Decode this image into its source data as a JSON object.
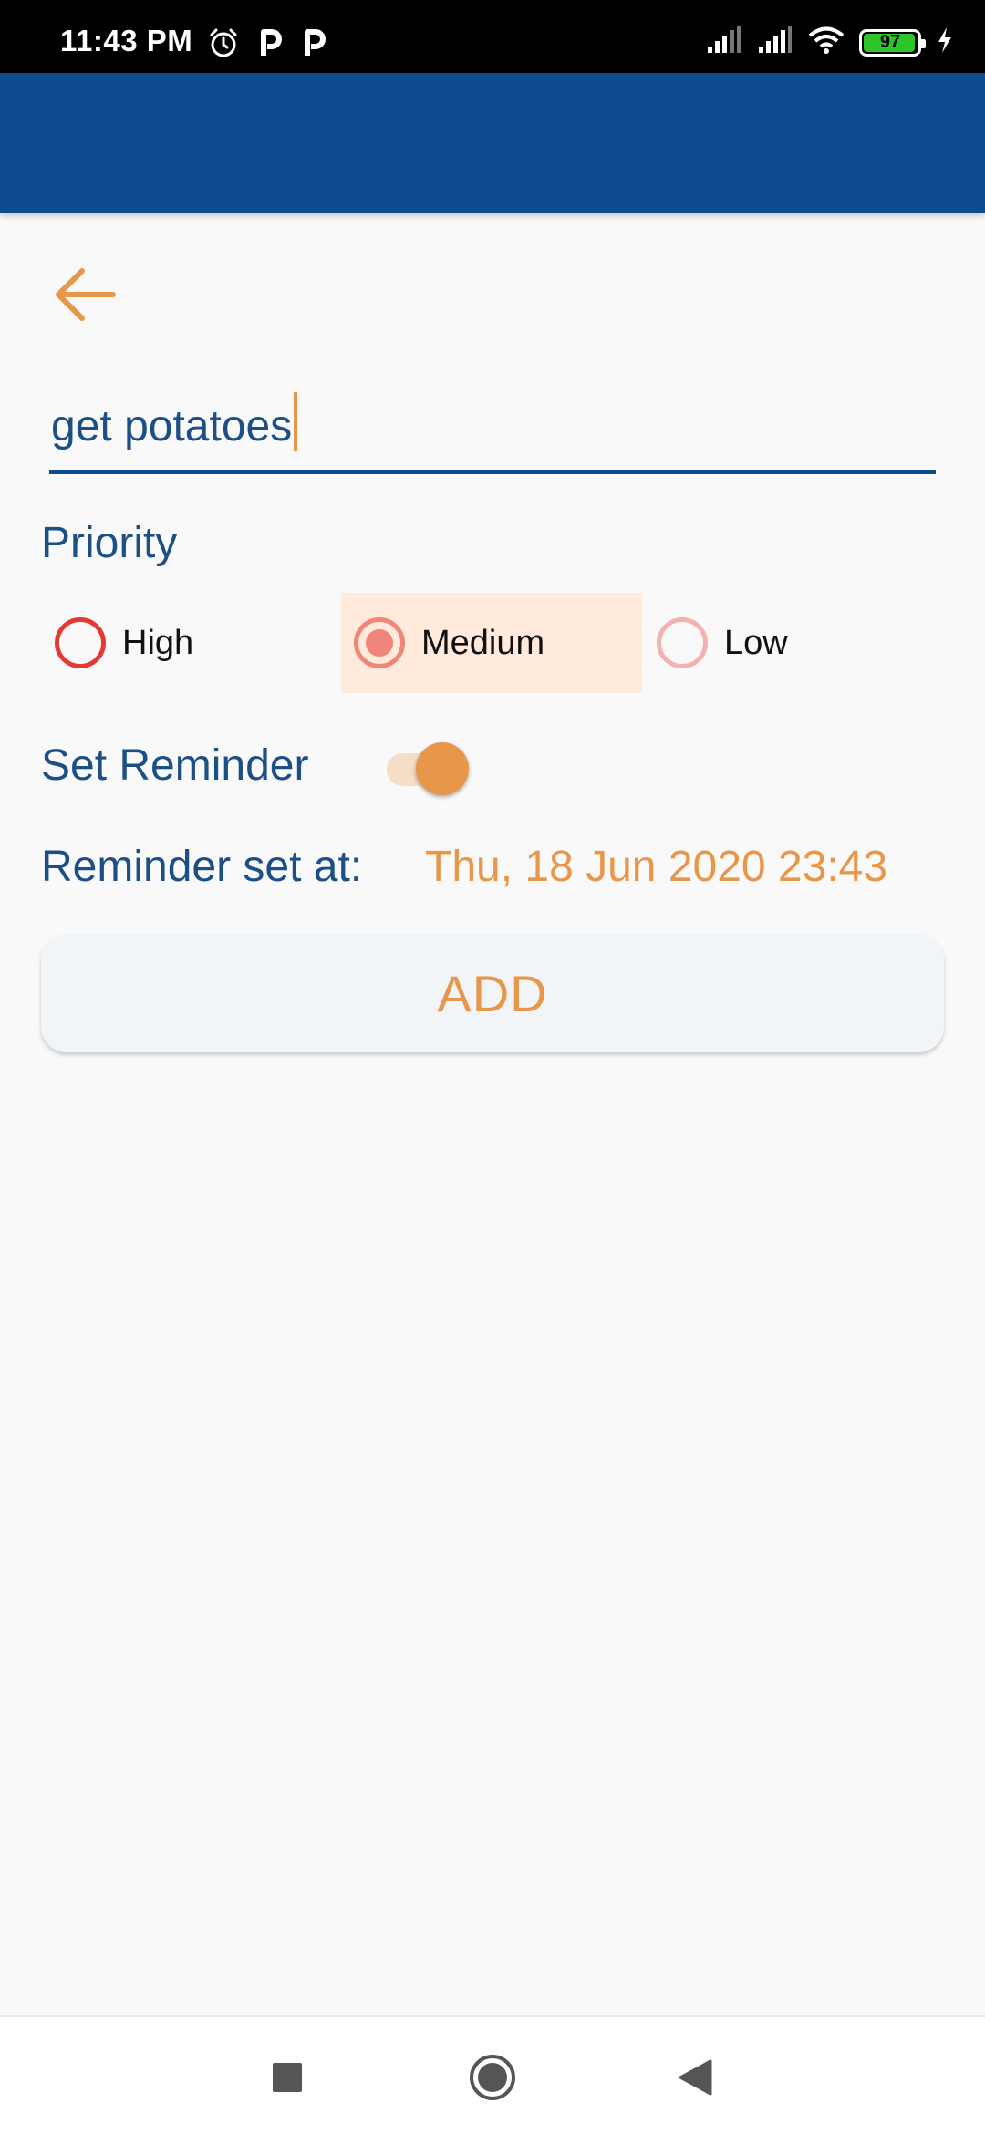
{
  "status_bar": {
    "time": "11:43 PM",
    "battery_level": "97",
    "battery_fraction": 0.97
  },
  "form": {
    "task_value": "get potatoes",
    "priority_label": "Priority",
    "priority_options": [
      {
        "label": "High",
        "color": "#e53935",
        "selected": false
      },
      {
        "label": "Medium",
        "color": "#f0857a",
        "selected": true
      },
      {
        "label": "Low",
        "color": "#f3b2b0",
        "selected": false
      }
    ],
    "reminder_label": "Set Reminder",
    "reminder_enabled": true,
    "reminder_set_at_label": "Reminder set at:",
    "reminder_datetime": "Thu, 18 Jun 2020 23:43",
    "add_button_label": "ADD"
  },
  "colors": {
    "app_bar": "#0d4d8f",
    "accent": "#e8974a",
    "label_text": "#1b4f86"
  },
  "icons": {
    "back": "arrow-left-icon",
    "nav_recents": "square-icon",
    "nav_home": "circle-icon",
    "nav_back": "triangle-back-icon"
  }
}
